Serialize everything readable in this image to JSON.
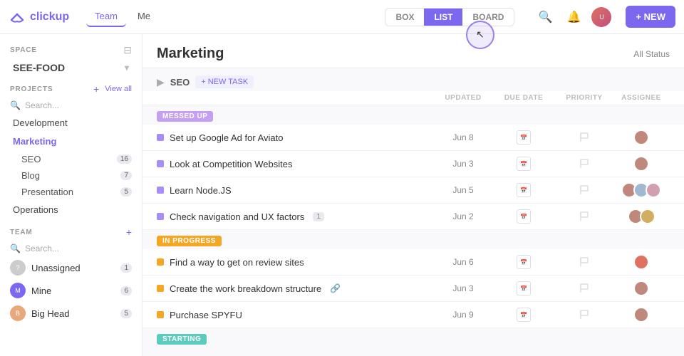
{
  "app": {
    "name": "clickup",
    "logo_text": "clickup"
  },
  "topnav": {
    "tabs": [
      {
        "label": "Team",
        "active": true
      },
      {
        "label": "Me",
        "active": false
      }
    ],
    "view_tabs": [
      {
        "label": "BOX",
        "active": false
      },
      {
        "label": "LIST",
        "active": true
      },
      {
        "label": "BOARD",
        "active": false
      }
    ],
    "new_button": "+ NEW"
  },
  "sidebar": {
    "space_label": "SPACE",
    "space_name": "SEE-FOOD",
    "projects_label": "PROJECTS",
    "view_all": "View all",
    "search_placeholder": "Search...",
    "projects": [
      {
        "name": "Development",
        "active": false,
        "count": null
      },
      {
        "name": "Marketing",
        "active": true,
        "count": null
      }
    ],
    "sub_items": [
      {
        "name": "SEO",
        "count": 16
      },
      {
        "name": "Blog",
        "count": 7
      },
      {
        "name": "Presentation",
        "count": 5
      }
    ],
    "other_projects": [
      {
        "name": "Operations",
        "active": false
      }
    ],
    "team_label": "TEAM",
    "team_search_placeholder": "Search...",
    "team_members": [
      {
        "name": "Unassigned",
        "count": 1,
        "color": "#ccc"
      },
      {
        "name": "Mine",
        "count": 6,
        "color": "#7b68ee"
      },
      {
        "name": "Big Head",
        "count": 5,
        "color": "#e8a87c"
      }
    ]
  },
  "content": {
    "page_title": "Marketing",
    "all_status": "All Status",
    "section_title": "SEO",
    "new_task_label": "+ NEW TASK",
    "columns": {
      "task": "",
      "updated": "UPDATED",
      "due_date": "DUE DATE",
      "priority": "PRIORITY",
      "assignee": "ASSIGNEE"
    },
    "groups": [
      {
        "id": "messed-up",
        "badge": "MESSED UP",
        "badge_class": "badge-messed-up",
        "dot_class": "dot-purple",
        "tasks": [
          {
            "name": "Set up Google Ad for Aviato",
            "updated": "Jun 8",
            "has_cal": true,
            "has_flag": true,
            "assignees": [
              "#c0887c"
            ],
            "badge": null
          },
          {
            "name": "Look at Competition Websites",
            "updated": "Jun 3",
            "has_cal": true,
            "has_flag": true,
            "assignees": [
              "#c0887c"
            ],
            "badge": null
          },
          {
            "name": "Learn Node.JS",
            "updated": "Jun 5",
            "has_cal": true,
            "has_flag": true,
            "assignees": [
              "#c0887c",
              "#a0b8d0",
              "#d0a0b0"
            ],
            "badge": null
          },
          {
            "name": "Check navigation and UX factors",
            "updated": "Jun 2",
            "has_cal": true,
            "has_flag": true,
            "assignees": [
              "#c0887c",
              "#d0b060"
            ],
            "badge": "1"
          }
        ]
      },
      {
        "id": "in-progress",
        "badge": "IN PROGRESS",
        "badge_class": "badge-in-progress",
        "dot_class": "dot-yellow",
        "tasks": [
          {
            "name": "Find a way to get on review sites",
            "updated": "Jun 6",
            "has_cal": true,
            "has_flag": true,
            "assignees": [
              "#e07060"
            ],
            "badge": null
          },
          {
            "name": "Create the work breakdown structure",
            "updated": "Jun 3",
            "has_cal": true,
            "has_flag": true,
            "assignees": [
              "#c0887c"
            ],
            "badge": null,
            "link": true
          },
          {
            "name": "Purchase SPYFU",
            "updated": "Jun 9",
            "has_cal": true,
            "has_flag": true,
            "assignees": [
              "#c0887c"
            ],
            "badge": null
          }
        ]
      },
      {
        "id": "starting",
        "badge": "STARTING",
        "badge_class": "badge-starting",
        "dot_class": "dot-teal",
        "tasks": []
      }
    ]
  }
}
